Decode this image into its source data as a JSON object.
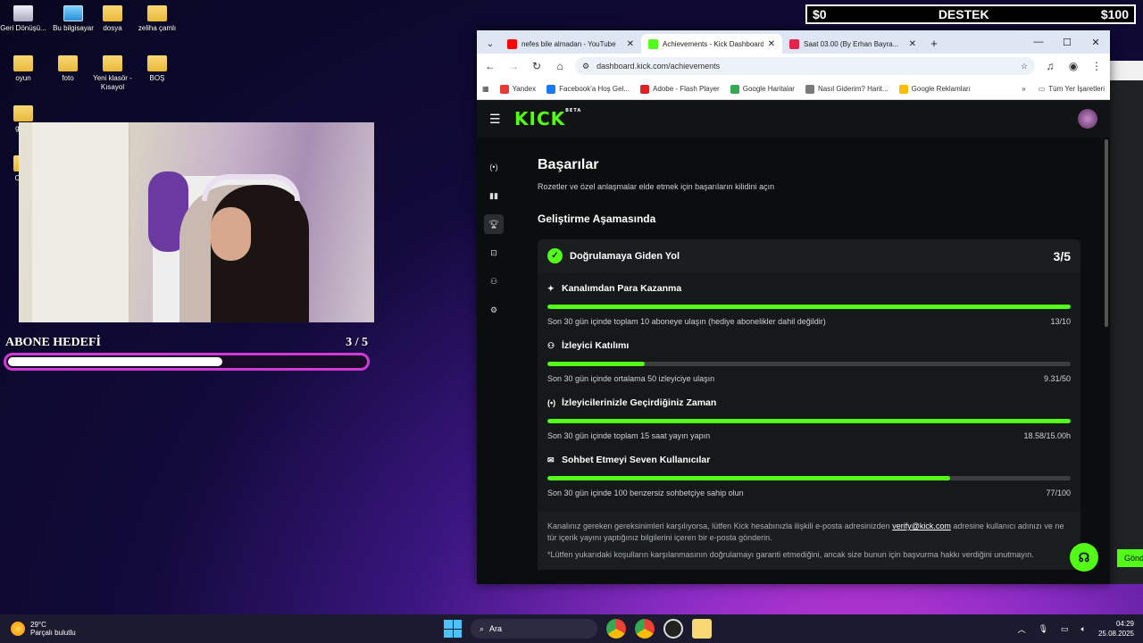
{
  "desktop": {
    "icons": [
      {
        "label": "Geri Dönüşü...",
        "type": "bin"
      },
      {
        "label": "Bu bilgisayar",
        "type": "monitor"
      },
      {
        "label": "dosya",
        "type": "folder"
      },
      {
        "label": "zeliha çamlı",
        "type": "folder"
      },
      {
        "label": "oyun",
        "type": "folder"
      },
      {
        "label": "foto",
        "type": "folder"
      },
      {
        "label": "Yeni klasör - Kısayol",
        "type": "folder"
      },
      {
        "label": "BOŞ",
        "type": "folder"
      },
      {
        "label": "good",
        "type": "folder"
      },
      {
        "label": "Coun",
        "type": "folder"
      }
    ]
  },
  "donation_bar": {
    "left": "$0",
    "center": "DESTEK",
    "right": "$100"
  },
  "goal": {
    "title": "ABONE HEDEFİ",
    "count": "3 / 5",
    "progress": 0.6
  },
  "browser": {
    "tabs": [
      {
        "title": "nefes bile almadan - YouTube",
        "color": "#ff0000",
        "active": false
      },
      {
        "title": "Achievements - Kick Dashboard",
        "color": "#53fc18",
        "active": true
      },
      {
        "title": "Saat 03.00 (By Erhan Bayra...",
        "color": "#e3244d",
        "active": false
      }
    ],
    "url": "dashboard.kick.com/achievements",
    "bookmarks": [
      "Yandex",
      "Facebook'a Hoş Gel...",
      "Adobe - Flash Player",
      "Google Haritalar",
      "Nasıl Giderim? Harit...",
      "Google Reklamları"
    ],
    "bookmarks_all": "Tüm Yer İşaretleri"
  },
  "kick": {
    "logo": "KICK",
    "logo_beta": "BETA",
    "title": "Başarılar",
    "subtitle": "Rozetler ve özel anlaşmalar elde etmek için başarıların kilidini açın",
    "section": "Geliştirme Aşamasında",
    "card_title": "Doğrulamaya Giden Yol",
    "card_score": "3/5",
    "items": [
      {
        "icon": "✦",
        "icon_name": "sparkle-icon",
        "title": "Kanalımdan Para Kazanma",
        "desc": "Son 30 gün içinde toplam 10 aboneye ulaşın (hediye abonelikler dahil değildir)",
        "value": "13/10",
        "progress": 1.0
      },
      {
        "icon": "⚇",
        "icon_name": "viewers-icon",
        "title": "İzleyici Katılımı",
        "desc": "Son 30 gün içinde ortalama 50 izleyiciye ulaşın",
        "value": "9.31/50",
        "progress": 0.186
      },
      {
        "icon": "(•)",
        "icon_name": "broadcast-icon",
        "title": "İzleyicilerinizle Geçirdiğiniz Zaman",
        "desc": "Son 30 gün içinde toplam 15 saat yayın yapın",
        "value": "18.58/15.00h",
        "progress": 1.0
      },
      {
        "icon": "✉",
        "icon_name": "chat-icon",
        "title": "Sohbet Etmeyi Seven Kullanıcılar",
        "desc": "Son 30 gün içinde 100 benzersiz sohbetçiye sahip olun",
        "value": "77/100",
        "progress": 0.77
      }
    ],
    "footer_1a": "Kanalınız gereken gereksinimleri karşılıyorsa, lütfen Kick hesabınızla ilişkili e-posta adresinizden",
    "footer_email": "verify@kick.com",
    "footer_1b": "adresine kullanıcı adınızı ve ne tür içerik yayını yaptığınız bilgilerini içeren bir e-posta gönderin.",
    "footer_2": "*Lütfen yukarıdaki koşulların karşılanmasının doğrulamayı garanti etmediğini, ancak size bunun için başvurma hakkı verdiğini unutmayın."
  },
  "side_button": "Gönd",
  "taskbar": {
    "temp": "29°C",
    "weather": "Parçalı bulutlu",
    "search_placeholder": "Ara",
    "time": "04:29",
    "date": "25.08.2025"
  }
}
